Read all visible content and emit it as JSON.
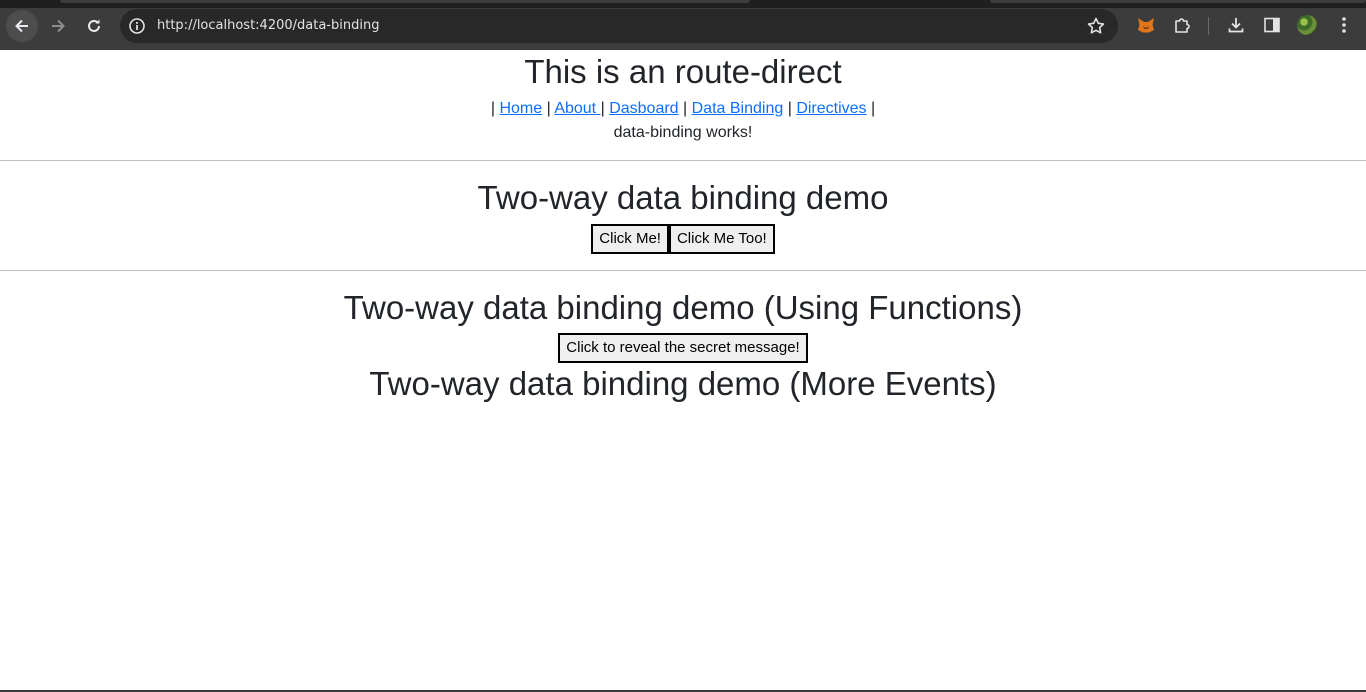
{
  "browser": {
    "url": "http://localhost:4200/data-binding",
    "icons": {
      "back": "arrow-left-icon",
      "forward": "arrow-right-icon",
      "reload": "reload-icon",
      "site_info": "info-icon",
      "bookmark": "star-icon",
      "extension_fox": "fox-extension-icon",
      "extensions": "puzzle-icon",
      "downloads": "download-icon",
      "side_panel": "side-panel-icon",
      "profile": "avatar",
      "menu": "kebab-menu-icon"
    }
  },
  "page": {
    "site_title": "This is an route-direct",
    "nav": {
      "separator": "|",
      "links": [
        "Home",
        "About ",
        "Dasboard",
        "Data Binding",
        "Directives"
      ]
    },
    "status_text": "data-binding works!",
    "section1": {
      "title": "Two-way data binding demo",
      "buttons": [
        "Click Me!",
        "Click Me Too!"
      ]
    },
    "section2": {
      "title": "Two-way data binding demo (Using Functions)",
      "button": "Click to reveal the secret message!"
    },
    "section3": {
      "title": "Two-way data binding demo (More Events)"
    }
  },
  "colors": {
    "link": "#0d6efd",
    "text": "#212529",
    "chrome_bg": "#3c3c3c",
    "omnibox_bg": "#282828"
  }
}
